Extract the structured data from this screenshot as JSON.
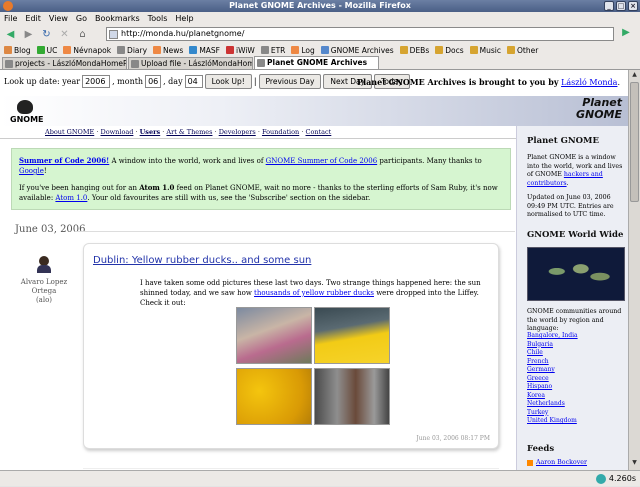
{
  "window": {
    "title": "Planet GNOME Archives - Mozilla Firefox"
  },
  "menu": [
    "File",
    "Edit",
    "View",
    "Go",
    "Bookmarks",
    "Tools",
    "Help"
  ],
  "nav": {
    "url": "http://monda.hu/planetgnome/"
  },
  "bookmarks": [
    {
      "label": "Blog",
      "color": "#d84"
    },
    {
      "label": "UC",
      "color": "#3a3"
    },
    {
      "label": "Névnapok",
      "color": "#e84"
    },
    {
      "label": "Diary",
      "color": "#888"
    },
    {
      "label": "News",
      "color": "#e84"
    },
    {
      "label": "MASF",
      "color": "#38c"
    },
    {
      "label": "iWiW",
      "color": "#c33"
    },
    {
      "label": "ETR",
      "color": "#888"
    },
    {
      "label": "Log",
      "color": "#e84"
    },
    {
      "label": "GNOME Archives",
      "color": "#58c"
    },
    {
      "label": "DEBs",
      "color": "#d6a430"
    },
    {
      "label": "Docs",
      "color": "#d6a430"
    },
    {
      "label": "Music",
      "color": "#d6a430"
    },
    {
      "label": "Other",
      "color": "#d6a430"
    }
  ],
  "tabs": [
    {
      "label": "projects - LászlóMondaHomePage",
      "active": false
    },
    {
      "label": "Upload file - LászlóMondaHomeP...",
      "active": false
    },
    {
      "label": "Planet GNOME Archives",
      "active": true
    }
  ],
  "lookup": {
    "prefix": "Look up date: year",
    "year": "2006",
    "month_label": ", month",
    "month": "06",
    "day_label": ", day",
    "day": "04",
    "lookup_btn": "Look Up!",
    "sep": "|",
    "prev_btn": "Previous Day",
    "next_btn": "Next Day",
    "today_btn": "Today"
  },
  "credit": {
    "text": "Planet GNOME Archives is brought to you by",
    "author": "László Monda",
    "period": "."
  },
  "header": {
    "gnome_logo": "GNOME",
    "planet_logo_1": "Planet",
    "planet_logo_2": "GNOME"
  },
  "sitenav": {
    "items": [
      "About GNOME",
      "Download",
      "Users",
      "Art & Themes",
      "Developers",
      "Foundation",
      "Contact"
    ],
    "sep": "·"
  },
  "notice": {
    "soc_link": "Summer of Code 2006!",
    "soc_text1": " A window into the world, work and lives of ",
    "soc_link2": "GNOME Summer of Code 2006",
    "soc_text2": " participants. Many thanks to ",
    "soc_link3": "Google",
    "soc_text3": "!",
    "atom_text1": "If you've been hanging out for an ",
    "atom_bold": "Atom 1.0",
    "atom_text2": " feed on Planet GNOME, wait no more - thanks to the sterling efforts of Sam Ruby, it's now available: ",
    "atom_link": "Atom 1.0",
    "atom_text3": ". Your old favourites are still with us, see the 'Subscribe' section on the sidebar."
  },
  "main": {
    "date": "June 03, 2006",
    "author_name_1": "Alvaro Lopez",
    "author_name_2": "Ortega",
    "author_handle": "(alo)",
    "post_title": "Dublin: Yellow rubber ducks.. and some sun",
    "post_text1": "I have taken some odd pictures these last two days. Two strange things happened here: the sun shinned today, and we saw how ",
    "post_link": "thousands of yellow rubber ducks",
    "post_text2": " were dropped into the Liffey. Check it out:",
    "post_time": "June 03, 2006 08:17 PM"
  },
  "sidebar": {
    "h1": "Planet GNOME",
    "desc1": "Planet GNOME is a window into the world, work and lives of GNOME ",
    "desc_link": "hackers and contributors",
    "desc2": ".",
    "updated": "Updated on June 03, 2006 09:49 PM UTC. Entries are normalised to UTC time.",
    "h2": "GNOME World Wide",
    "communities": "GNOME communities around the world by region and language:",
    "regions": [
      "Bangalore, India",
      "Bulgaria",
      "Chile",
      "French",
      "Germany",
      "Greece",
      "Hispano",
      "Korea",
      "Netherlands",
      "Turkey",
      "United Kingdom"
    ],
    "h3": "Feeds",
    "feed1": "Aaron Bockover"
  },
  "status": {
    "time": "4.260s"
  }
}
